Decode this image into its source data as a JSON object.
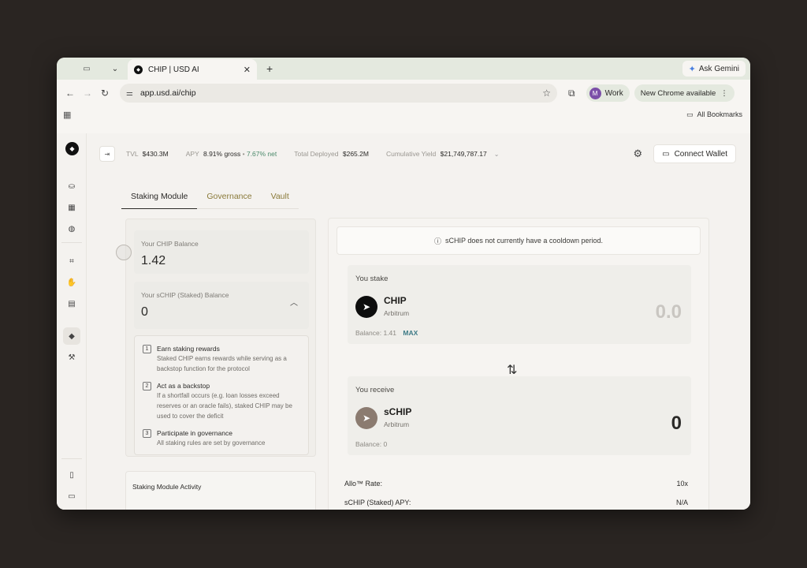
{
  "browser": {
    "tab_title": "CHIP | USD AI",
    "ask_gemini": "Ask Gemini",
    "url": "app.usd.ai/chip",
    "profile_name": "Work",
    "profile_initial": "M",
    "update_label": "New Chrome available",
    "all_bookmarks": "All Bookmarks"
  },
  "stats": {
    "tvl_label": "TVL",
    "tvl_value": "$430.3M",
    "apy_label": "APY",
    "apy_gross": "8.91% gross",
    "apy_sep": "•",
    "apy_net": "7.67% net",
    "deployed_label": "Total Deployed",
    "deployed_value": "$265.2M",
    "yield_label": "Cumulative Yield",
    "yield_value": "$21,749,787.17",
    "connect_wallet": "Connect Wallet"
  },
  "tabs": [
    {
      "label": "Staking Module",
      "active": true
    },
    {
      "label": "Governance",
      "active": false
    },
    {
      "label": "Vault",
      "active": false
    }
  ],
  "balances": {
    "chip_label": "Your CHIP Balance",
    "chip_value": "1.42",
    "schip_label": "Your sCHIP (Staked) Balance",
    "schip_value": "0"
  },
  "info_items": [
    {
      "num": "1",
      "title": "Earn staking rewards",
      "desc": "Staked CHIP earns rewards while serving as a backstop function for the protocol"
    },
    {
      "num": "2",
      "title": "Act as a backstop",
      "desc": "If a shortfall occurs (e.g. loan losses exceed reserves or an oracle fails), staked CHIP may be used to cover the deficit"
    },
    {
      "num": "3",
      "title": "Participate in governance",
      "desc": "All staking rules are set by governance"
    }
  ],
  "activity_title": "Staking Module Activity",
  "cooldown_text": "sCHIP does not currently have a cooldown period.",
  "stake": {
    "heading": "You stake",
    "token": "CHIP",
    "network": "Arbitrum",
    "amount": "0.0",
    "balance": "Balance: 1.41",
    "max": "MAX"
  },
  "receive": {
    "heading": "You receive",
    "token": "sCHIP",
    "network": "Arbitrum",
    "amount": "0",
    "balance": "Balance: 0"
  },
  "rates": [
    {
      "label": "Allo™ Rate:",
      "value": "10x"
    },
    {
      "label": "sCHIP (Staked) APY:",
      "value": "N/A"
    }
  ],
  "colors": {
    "accent_tab": "#8a7a3a",
    "max_link": "#3d7a86",
    "net_apy": "#4b8a6b"
  }
}
